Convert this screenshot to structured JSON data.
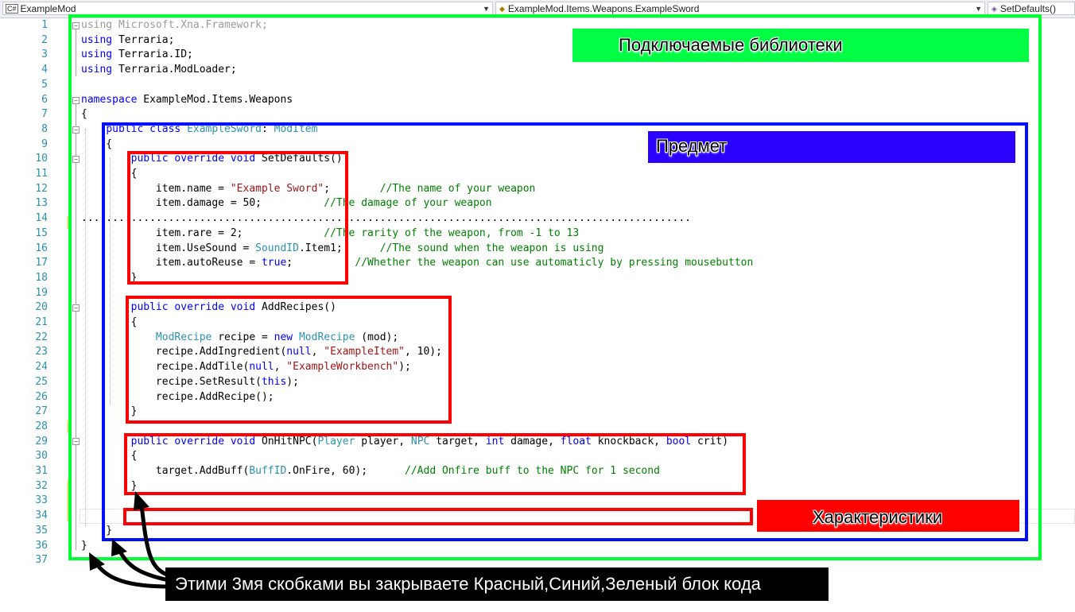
{
  "navbar": {
    "project": "ExampleMod",
    "type_path": "ExampleMod.Items.Weapons.ExampleSword",
    "member": "SetDefaults()"
  },
  "colors": {
    "green": "#00ff33",
    "blue": "#0010ff",
    "red": "#ff0000",
    "label_blue": "#2b00ff"
  },
  "lines": [
    {
      "n": "1",
      "t": [
        [
          "gr",
          "using Microsoft.Xna.Framework;"
        ]
      ]
    },
    {
      "n": "2",
      "t": [
        [
          "kw",
          "using"
        ],
        [
          "",
          "Terraria;"
        ]
      ]
    },
    {
      "n": "3",
      "t": [
        [
          "kw",
          "using"
        ],
        [
          "",
          "Terraria.ID;"
        ]
      ]
    },
    {
      "n": "4",
      "t": [
        [
          "kw",
          "using"
        ],
        [
          "",
          "Terraria.ModLoader;"
        ]
      ]
    },
    {
      "n": "5",
      "t": []
    },
    {
      "n": "6",
      "t": [
        [
          "kw",
          "namespace"
        ],
        [
          "",
          "ExampleMod.Items.Weapons"
        ]
      ]
    },
    {
      "n": "7",
      "t": [
        [
          "",
          "{"
        ]
      ]
    },
    {
      "n": "8",
      "t": [
        [
          "",
          "    "
        ],
        [
          "kw",
          "public class"
        ],
        [
          "ty",
          "ExampleSword"
        ],
        [
          "",
          ":"
        ],
        [
          "ty",
          "ModItem"
        ]
      ]
    },
    {
      "n": "9",
      "t": [
        [
          "",
          "    {"
        ]
      ]
    },
    {
      "n": "10",
      "t": [
        [
          "",
          "        "
        ],
        [
          "kw",
          "public override void"
        ],
        [
          "",
          "SetDefaults()"
        ]
      ]
    },
    {
      "n": "11",
      "t": [
        [
          "",
          "        {"
        ]
      ]
    },
    {
      "n": "12",
      "t": [
        [
          "",
          "            item.name = "
        ],
        [
          "str",
          "\"Example Sword\""
        ],
        [
          "",
          ";        "
        ],
        [
          "cm",
          "//The name of your weapon"
        ]
      ]
    },
    {
      "n": "13",
      "t": [
        [
          "",
          "            item.damage = 50;          "
        ],
        [
          "cm",
          "//The damage of your weapon"
        ]
      ]
    },
    {
      "n": "14",
      "t": [
        [
          "",
          ".................................................................................................."
        ]
      ]
    },
    {
      "n": "15",
      "t": [
        [
          "",
          "            item.rare = 2;             "
        ],
        [
          "cm",
          "//The rarity of the weapon, from -1 to 13"
        ]
      ]
    },
    {
      "n": "16",
      "t": [
        [
          "",
          "            item.UseSound = "
        ],
        [
          "ty",
          "SoundID"
        ],
        [
          "",
          ".Item1;      "
        ],
        [
          "cm",
          "//The sound when the weapon is using"
        ]
      ]
    },
    {
      "n": "17",
      "t": [
        [
          "",
          "            item.autoReuse = "
        ],
        [
          "kw",
          "true"
        ],
        [
          "",
          ";          "
        ],
        [
          "cm",
          "//Whether the weapon can use automaticly by pressing mousebutton"
        ]
      ]
    },
    {
      "n": "18",
      "t": [
        [
          "",
          "        }"
        ]
      ]
    },
    {
      "n": "19",
      "t": []
    },
    {
      "n": "20",
      "t": [
        [
          "",
          "        "
        ],
        [
          "kw",
          "public override void"
        ],
        [
          "",
          "AddRecipes()"
        ]
      ]
    },
    {
      "n": "21",
      "t": [
        [
          "",
          "        {"
        ]
      ]
    },
    {
      "n": "22",
      "t": [
        [
          "",
          "            "
        ],
        [
          "ty",
          "ModRecipe"
        ],
        [
          "",
          "recipe = "
        ],
        [
          "kw",
          "new"
        ],
        [
          "ty",
          "ModRecipe"
        ],
        [
          "",
          "(mod);"
        ]
      ]
    },
    {
      "n": "23",
      "t": [
        [
          "",
          "            recipe.AddIngredient("
        ],
        [
          "kw",
          "null"
        ],
        [
          "",
          ", "
        ],
        [
          "str",
          "\"ExampleItem\""
        ],
        [
          "",
          ", 10);"
        ]
      ]
    },
    {
      "n": "24",
      "t": [
        [
          "",
          "            recipe.AddTile("
        ],
        [
          "kw",
          "null"
        ],
        [
          "",
          ", "
        ],
        [
          "str",
          "\"ExampleWorkbench\""
        ],
        [
          "",
          ");"
        ]
      ]
    },
    {
      "n": "25",
      "t": [
        [
          "",
          "            recipe.SetResult("
        ],
        [
          "kw",
          "this"
        ],
        [
          "",
          ");"
        ]
      ]
    },
    {
      "n": "26",
      "t": [
        [
          "",
          "            recipe.AddRecipe();"
        ]
      ]
    },
    {
      "n": "27",
      "t": [
        [
          "",
          "        }"
        ]
      ]
    },
    {
      "n": "28",
      "t": []
    },
    {
      "n": "29",
      "t": [
        [
          "",
          "        "
        ],
        [
          "kw",
          "public override void"
        ],
        [
          "",
          "OnHitNPC("
        ],
        [
          "ty",
          "Player"
        ],
        [
          "",
          "player, "
        ],
        [
          "ty",
          "NPC"
        ],
        [
          "",
          "target, "
        ],
        [
          "kw",
          "int"
        ],
        [
          "",
          "damage, "
        ],
        [
          "kw",
          "float"
        ],
        [
          "",
          "knockback, "
        ],
        [
          "kw",
          "bool"
        ],
        [
          "",
          "crit)"
        ]
      ]
    },
    {
      "n": "30",
      "t": [
        [
          "",
          "        {"
        ]
      ]
    },
    {
      "n": "31",
      "t": [
        [
          "",
          "            target.AddBuff("
        ],
        [
          "ty",
          "BuffID"
        ],
        [
          "",
          ".OnFire, 60);      "
        ],
        [
          "cm",
          "//Add Onfire buff to the NPC for 1 second"
        ]
      ]
    },
    {
      "n": "32",
      "t": [
        [
          "",
          "        }"
        ]
      ]
    },
    {
      "n": "33",
      "t": []
    },
    {
      "n": "34",
      "t": []
    },
    {
      "n": "35",
      "t": [
        [
          "",
          "    }"
        ]
      ]
    },
    {
      "n": "36",
      "t": [
        [
          "",
          "}"
        ]
      ]
    },
    {
      "n": "37",
      "t": []
    }
  ],
  "labels": {
    "libraries": "Подключаемые библиотеки",
    "item": "Предмет",
    "characteristics": "Характеристики"
  },
  "caption": "Этими 3мя скобками вы закрываете Красный,Синий,Зеленый блок кода"
}
